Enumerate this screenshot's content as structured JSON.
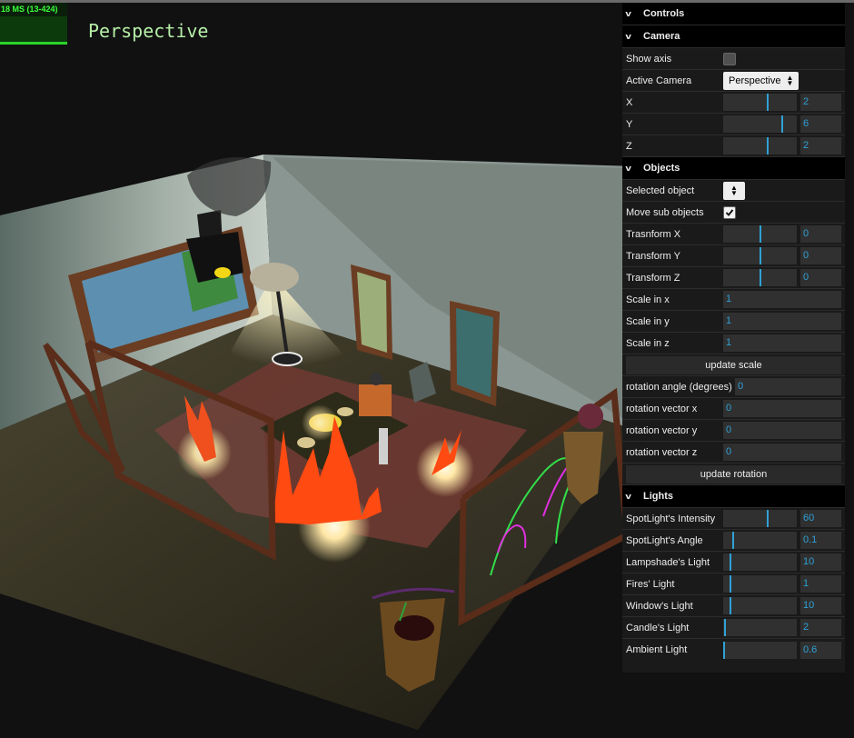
{
  "stats": {
    "text": "18 MS (13-424)"
  },
  "viewport": {
    "label": "Perspective"
  },
  "gui": {
    "controls_title": "Controls",
    "camera": {
      "title": "Camera",
      "show_axis": "Show axis",
      "active_camera_label": "Active Camera",
      "active_camera_value": "Perspective",
      "x_label": "X",
      "x_value": "2",
      "x_fill": 0.6,
      "y_label": "Y",
      "y_value": "6",
      "y_fill": 0.8,
      "z_label": "Z",
      "z_value": "2",
      "z_fill": 0.6
    },
    "objects": {
      "title": "Objects",
      "selected_object": "Selected object",
      "move_sub_objects": "Move sub objects",
      "tx_label": "Trasnform X",
      "tx_value": "0",
      "tx_fill": 0.5,
      "ty_label": "Transform Y",
      "ty_value": "0",
      "ty_fill": 0.5,
      "tz_label": "Transform Z",
      "tz_value": "0",
      "tz_fill": 0.5,
      "sx_label": "Scale in x",
      "sx_value": "1",
      "sy_label": "Scale in y",
      "sy_value": "1",
      "sz_label": "Scale in z",
      "sz_value": "1",
      "update_scale": "update scale",
      "rot_angle_label": "rotation angle (degrees)",
      "rot_angle_value": "0",
      "rvx_label": "rotation vector x",
      "rvx_value": "0",
      "rvy_label": "rotation vector y",
      "rvy_value": "0",
      "rvz_label": "rotation vector z",
      "rvz_value": "0",
      "update_rotation": "update rotation"
    },
    "lights": {
      "title": "Lights",
      "spot_int_label": "SpotLight's Intensity",
      "spot_int_value": "60",
      "spot_angle_label": "SpotLight's Angle",
      "spot_angle_value": "0.1",
      "lampshade_label": "Lampshade's Light",
      "lampshade_value": "10",
      "fires_label": "Fires' Light",
      "fires_value": "1",
      "window_label": "Window's Light",
      "window_value": "10",
      "candle_label": "Candle's Light",
      "candle_value": "2",
      "ambient_label": "Ambient Light",
      "ambient_value": "0.6"
    }
  },
  "colors": {
    "accent": "#2fa1d6",
    "panel": "#1a1a1a",
    "fire": "#ff4a12"
  }
}
